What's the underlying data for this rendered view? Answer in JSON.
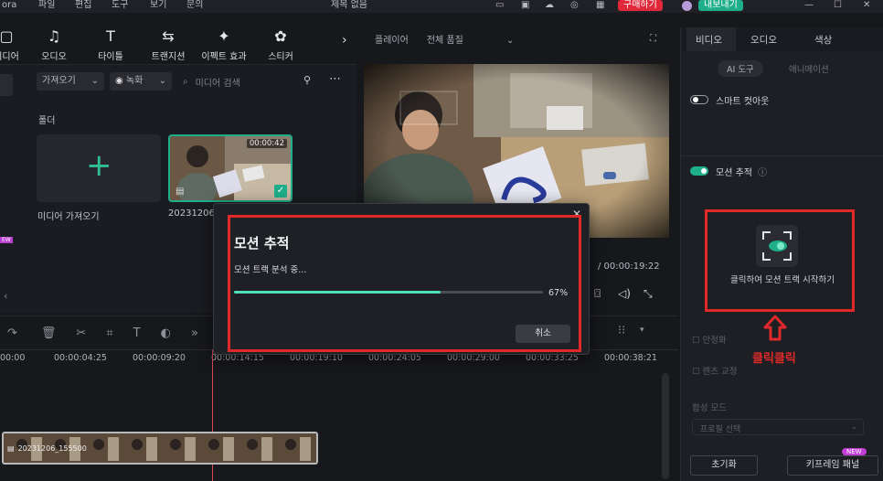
{
  "titlebar": {
    "app_name": "ora",
    "menus": [
      "파일",
      "편집",
      "도구",
      "보기",
      "문의"
    ],
    "document_title": "제목 없음",
    "buy_label": "구매하기",
    "export_label": "내보내기"
  },
  "media_tabs": [
    {
      "label": "미디어",
      "icon": "media-icon"
    },
    {
      "label": "오디오",
      "icon": "music-note-icon"
    },
    {
      "label": "타이틀",
      "icon": "title-icon"
    },
    {
      "label": "트랜지션",
      "icon": "transition-icon"
    },
    {
      "label": "이펙트 효과",
      "icon": "effect-icon"
    },
    {
      "label": "스티커",
      "icon": "sticker-icon"
    }
  ],
  "media": {
    "import_select": "가져오기",
    "record_select": "녹화",
    "search_placeholder": "미디어 검색",
    "folder_label": "폴더",
    "import_tile_label": "미디어 가져오기",
    "clip": {
      "name": "20231206_",
      "duration": "00:00:42"
    }
  },
  "player": {
    "player_label": "플레이어",
    "quality_label": "전체 품질",
    "total_time": "/ 00:00:19:22"
  },
  "right_panel": {
    "tabs": [
      "비디오",
      "오디오",
      "색상"
    ],
    "subtabs": [
      "AI 도구",
      "애니메이션"
    ],
    "smart_cutout_label": "스마트 컷아웃",
    "motion_tracking_label": "모션 추적",
    "start_tracking_label": "클릭하여 모션 트랙 시작하기",
    "option_1": "안정화",
    "option_2": "렌즈 교정",
    "blend_label": "합성 모드",
    "blend_value": "프로필 선택",
    "reset_label": "초기화",
    "keyframe_label": "키프레임 패널",
    "new_badge": "NEW"
  },
  "annotation": {
    "label": "클릭클릭",
    "color": "#e02a2a"
  },
  "timeline": {
    "ticks": [
      "00:00",
      "00:00:04:25",
      "00:00:09:20",
      "00:00:14:15",
      "00:00:19:10",
      "00:00:24:05",
      "00:00:29:00",
      "00:00:33:25",
      "00:00:38:21"
    ],
    "clip_label": "20231206_155500"
  },
  "dialog": {
    "title": "모션 추적",
    "status": "모션 트랙 분석 중...",
    "progress": 0.67,
    "progress_label": "67%",
    "cancel_label": "취소"
  },
  "colors": {
    "accent": "#1fae8a",
    "highlight": "#e02a2a",
    "buy": "#e0283a"
  }
}
